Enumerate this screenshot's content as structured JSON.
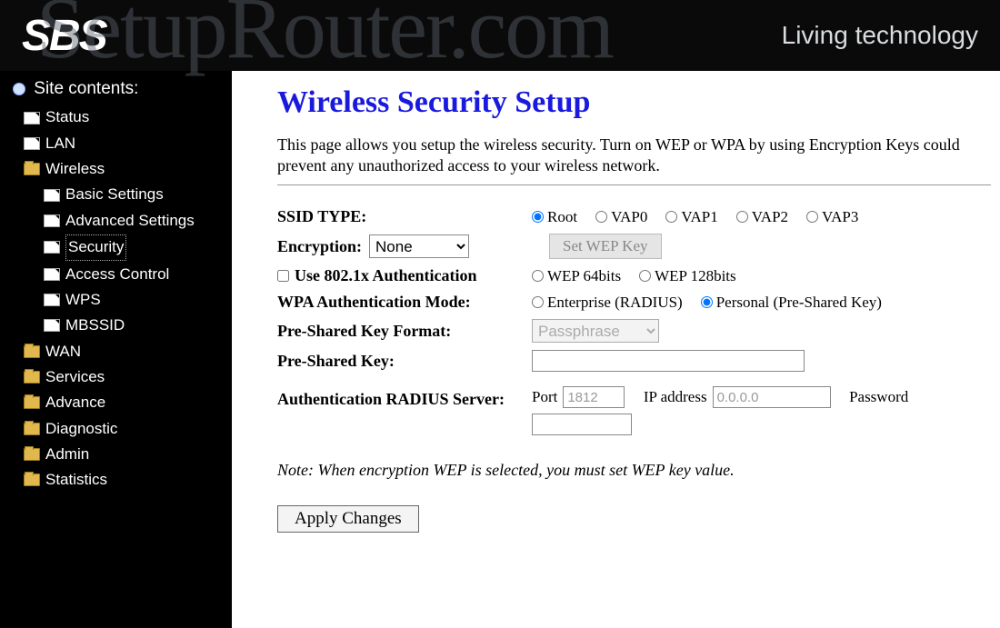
{
  "header": {
    "logo": "SBS",
    "tagline": "Living technology"
  },
  "watermark": "SetupRouter.com",
  "sidebar": {
    "title": "Site contents:",
    "items": [
      {
        "label": "Status",
        "type": "file"
      },
      {
        "label": "LAN",
        "type": "file"
      },
      {
        "label": "Wireless",
        "type": "folder-open",
        "children": [
          {
            "label": "Basic Settings",
            "type": "file"
          },
          {
            "label": "Advanced Settings",
            "type": "file"
          },
          {
            "label": "Security",
            "type": "file",
            "selected": true
          },
          {
            "label": "Access Control",
            "type": "file"
          },
          {
            "label": "WPS",
            "type": "file"
          },
          {
            "label": "MBSSID",
            "type": "file"
          }
        ]
      },
      {
        "label": "WAN",
        "type": "folder"
      },
      {
        "label": "Services",
        "type": "folder"
      },
      {
        "label": "Advance",
        "type": "folder"
      },
      {
        "label": "Diagnostic",
        "type": "folder"
      },
      {
        "label": "Admin",
        "type": "folder"
      },
      {
        "label": "Statistics",
        "type": "folder"
      }
    ]
  },
  "main": {
    "title": "Wireless Security Setup",
    "description": "This page allows you setup the wireless security. Turn on WEP or WPA by using Encryption Keys could prevent any unauthorized access to your wireless network.",
    "ssid_label": "SSID TYPE:",
    "ssid_options": [
      "Root",
      "VAP0",
      "VAP1",
      "VAP2",
      "VAP3"
    ],
    "ssid_selected": "Root",
    "encryption_label": "Encryption:",
    "encryption_value": "None",
    "set_wep_label": "Set WEP Key",
    "use8021x_label": "Use 802.1x Authentication",
    "wep_options": [
      "WEP 64bits",
      "WEP 128bits"
    ],
    "wpa_mode_label": "WPA Authentication Mode:",
    "wpa_options": [
      "Enterprise (RADIUS)",
      "Personal (Pre-Shared Key)"
    ],
    "wpa_selected": "Personal (Pre-Shared Key)",
    "psk_format_label": "Pre-Shared Key Format:",
    "psk_format_value": "Passphrase",
    "psk_label": "Pre-Shared Key:",
    "psk_value": "",
    "radius_label": "Authentication RADIUS Server:",
    "port_label": "Port",
    "port_value": "1812",
    "ip_label": "IP address",
    "ip_value": "0.0.0.0",
    "password_label": "Password",
    "note": "Note: When encryption WEP is selected, you must set WEP key value.",
    "apply_label": "Apply Changes"
  }
}
